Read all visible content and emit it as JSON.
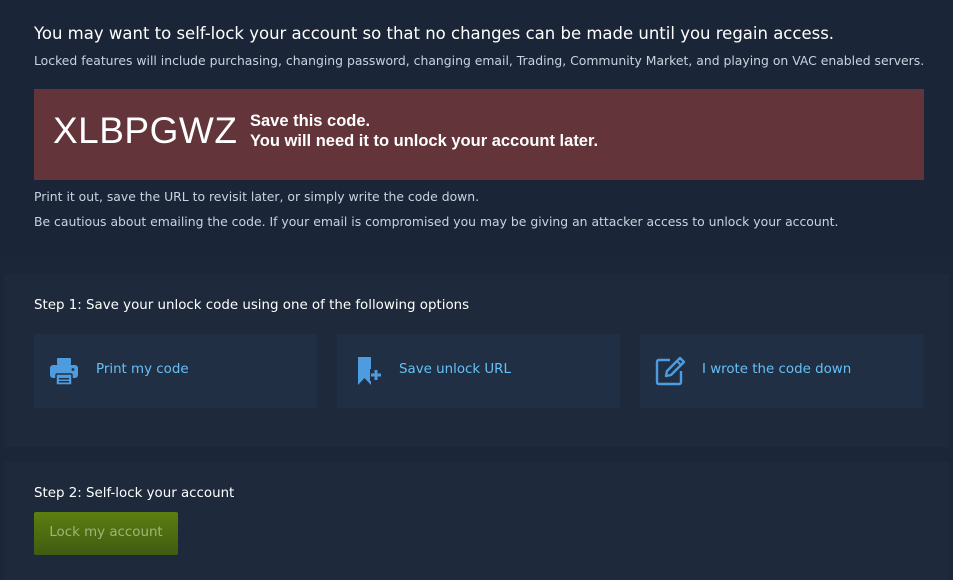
{
  "intro": {
    "headline": "You may want to self-lock your account so that no changes can be made until you regain access.",
    "subline": "Locked features will include purchasing, changing password, changing email, Trading, Community Market, and playing on VAC enabled servers."
  },
  "code_box": {
    "code": "XLBPGWZ",
    "message_line1": "Save this code.",
    "message_line2": "You will need it to unlock your account later."
  },
  "notes": {
    "note1": "Print it out, save the URL to revisit later, or simply write the code down.",
    "note2": "Be cautious about emailing the code. If your email is compromised you may be giving an attacker access to unlock your account."
  },
  "step1": {
    "title": "Step 1: Save your unlock code using one of the following options",
    "options": [
      {
        "label": "Print my code",
        "icon": "printer-icon"
      },
      {
        "label": "Save unlock URL",
        "icon": "bookmark-plus-icon"
      },
      {
        "label": "I wrote the code down",
        "icon": "pencil-square-icon"
      }
    ]
  },
  "step2": {
    "title": "Step 2: Self-lock your account",
    "button_label": "Lock my account"
  },
  "colors": {
    "background": "#1b2738",
    "panel": "#1e2a3c",
    "code_box": "#63343a",
    "option_bg": "#212f45",
    "link_blue": "#66c0f4",
    "button_green": "#5c7e10"
  }
}
